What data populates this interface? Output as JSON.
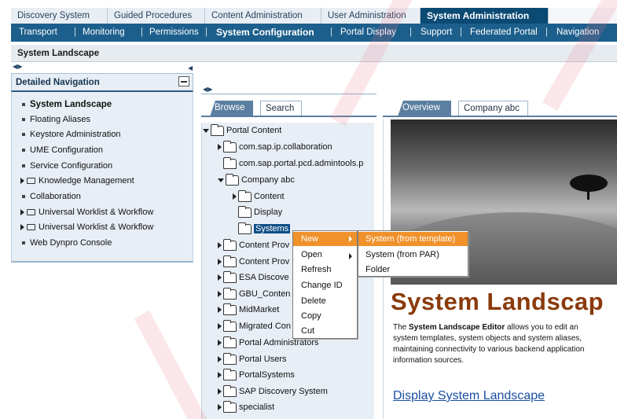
{
  "top_tabs": [
    "Discovery System",
    "Guided Procedures",
    "Content Administration",
    "User Administration",
    "System Administration"
  ],
  "active_top_tab": "System Administration",
  "sub_nav": [
    "Transport",
    "Monitoring",
    "Permissions",
    "System Configuration",
    "Portal Display",
    "Support",
    "Federated Portal",
    "Navigation"
  ],
  "active_sub_nav": "System Configuration",
  "page_title": "System Landscape",
  "detailed_navigation": {
    "title": "Detailed Navigation",
    "items": [
      {
        "label": "System Landscape",
        "bold": true
      },
      {
        "label": "Floating Aliases"
      },
      {
        "label": "Keystore Administration"
      },
      {
        "label": "UME Configuration"
      },
      {
        "label": "Service Configuration"
      },
      {
        "label": "Knowledge Management",
        "folder": true
      },
      {
        "label": "Collaboration"
      },
      {
        "label": "Universal Worklist & Workflow",
        "folder": true
      },
      {
        "label": "Universal Worklist & Workflow",
        "folder": true
      },
      {
        "label": "Web Dynpro Console"
      }
    ]
  },
  "middle_tabs": {
    "browse": "Browse",
    "search": "Search"
  },
  "tree": [
    {
      "label": "Portal Content",
      "level": 0,
      "expanded": true
    },
    {
      "label": "com.sap.ip.collaboration",
      "level": 1,
      "expander": true
    },
    {
      "label": "com.sap.portal.pcd.admintools.p",
      "level": 1
    },
    {
      "label": "Company abc",
      "level": 1,
      "expanded": true
    },
    {
      "label": "Content",
      "level": 2,
      "expander": true
    },
    {
      "label": "Display",
      "level": 2
    },
    {
      "label": "Systems",
      "level": 2,
      "selected": true
    },
    {
      "label": "Content Prov",
      "level": 1,
      "expander": true
    },
    {
      "label": "Content Prov",
      "level": 1,
      "expander": true
    },
    {
      "label": "ESA Discove",
      "level": 1,
      "expander": true
    },
    {
      "label": "GBU_Conten",
      "level": 1,
      "expander": true
    },
    {
      "label": "MidMarket",
      "level": 1,
      "expander": true
    },
    {
      "label": "Migrated Con",
      "level": 1,
      "expander": true
    },
    {
      "label": "Portal Administrators",
      "level": 1,
      "expander": true
    },
    {
      "label": "Portal Users",
      "level": 1,
      "expander": true
    },
    {
      "label": "PortalSystems",
      "level": 1,
      "expander": true
    },
    {
      "label": "SAP Discovery System",
      "level": 1,
      "expander": true
    },
    {
      "label": "specialist",
      "level": 1,
      "expander": true
    }
  ],
  "right_tabs": {
    "overview": "Overview",
    "company": "Company abc"
  },
  "context_menu": [
    "New",
    "Open",
    "Refresh",
    "Change ID",
    "Delete",
    "Copy",
    "Cut"
  ],
  "submenu": [
    "System (from template)",
    "System (from PAR)",
    "Folder"
  ],
  "banner_title": "System Landscap",
  "description": {
    "pre": "The ",
    "strong": "System Landscape Editor",
    "post": " allows you to edit an",
    "line2": "system templates, system objects and system aliases,",
    "line3": "maintaining connectivity to various backend application",
    "line4": "information sources."
  },
  "display_link": "Display System Landscape",
  "colors": {
    "top_active": "#0b4a73",
    "subnav": "#1c5f8c",
    "menu_highlight": "#f0912a",
    "banner": "#8a3a0a"
  }
}
